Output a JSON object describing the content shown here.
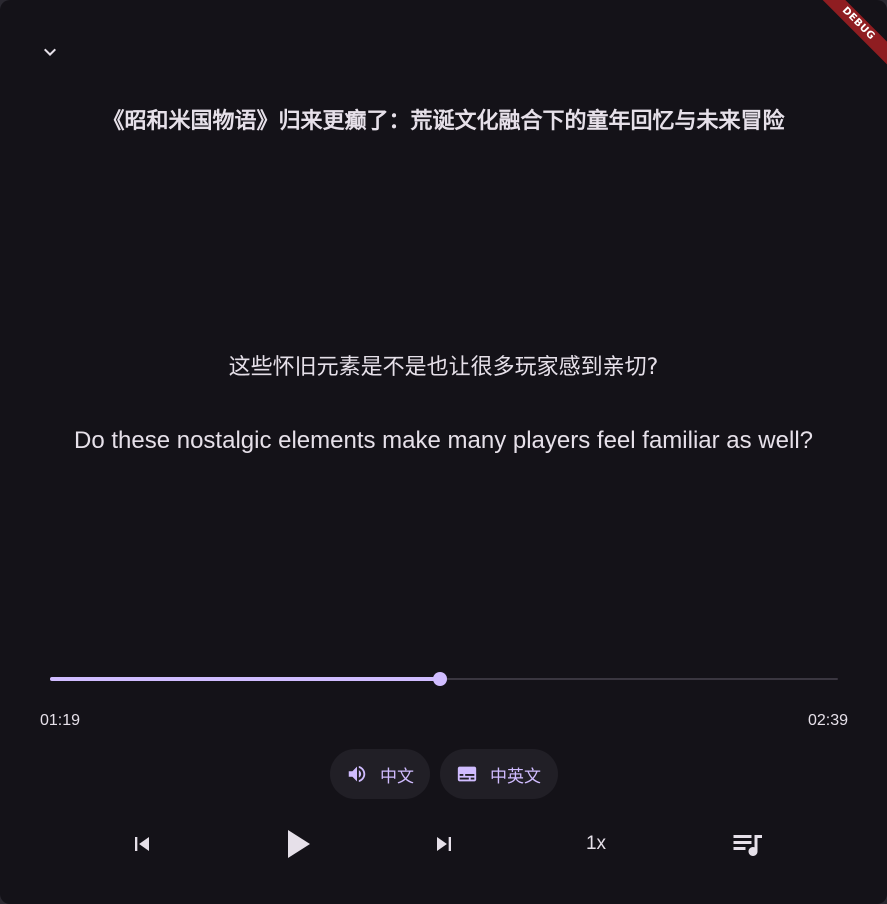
{
  "header": {
    "title": "《昭和米国物语》归来更癫了：荒诞文化融合下的童年回忆与未来冒险",
    "collapse_icon": "chevron-down-icon",
    "debug_badge": "DEBUG"
  },
  "subtitle": {
    "chinese": "这些怀旧元素是不是也让很多玩家感到亲切?",
    "english": "Do these nostalgic elements make many players feel familiar as well?"
  },
  "playback": {
    "current_time": "01:19",
    "total_time": "02:39",
    "progress_fraction": 0.495
  },
  "chips": {
    "audio": {
      "icon": "volume-icon",
      "label": "中文"
    },
    "subtitles": {
      "icon": "subtitles-icon",
      "label": "中英文"
    }
  },
  "controls": {
    "previous_icon": "skip-previous-icon",
    "play_icon": "play-icon",
    "next_icon": "skip-next-icon",
    "speed_label": "1x",
    "playlist_icon": "playlist-icon"
  },
  "colors": {
    "background": "#141218",
    "accent": "#d0bcff",
    "text": "#e6e0e9",
    "chip_background": "#211f26",
    "debug_banner": "#8f1d21"
  }
}
